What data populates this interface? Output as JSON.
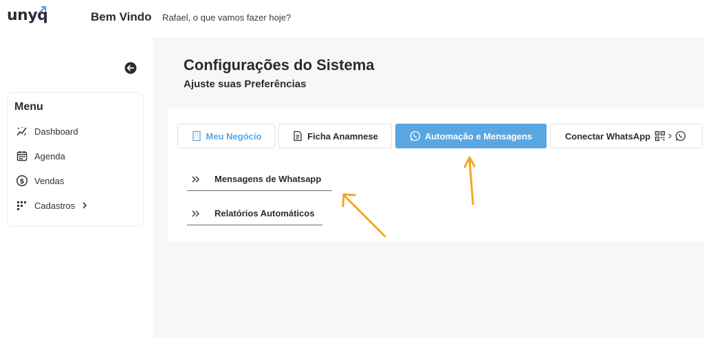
{
  "header": {
    "logo_text": "unyq",
    "welcome_title": "Bem Vindo",
    "welcome_subtitle": "Rafael, o que vamos fazer hoje?"
  },
  "sidebar": {
    "menu_title": "Menu",
    "items": [
      {
        "label": "Dashboard",
        "icon": "dashboard-icon"
      },
      {
        "label": "Agenda",
        "icon": "calendar-icon"
      },
      {
        "label": "Vendas",
        "icon": "dollar-icon"
      },
      {
        "label": "Cadastros",
        "icon": "grid-icon"
      }
    ]
  },
  "main": {
    "title": "Configurações do Sistema",
    "subtitle": "Ajuste suas Preferências",
    "tabs": [
      {
        "label": "Meu Negócio",
        "icon": "building-icon"
      },
      {
        "label": "Ficha Anamnese",
        "icon": "document-icon"
      },
      {
        "label": "Automação e Mensagens",
        "icon": "whatsapp-icon",
        "active": true
      },
      {
        "label": "Conectar WhatsApp",
        "icon": "qrcode-icon"
      }
    ],
    "submenu": [
      {
        "label": "Mensagens de Whatsapp"
      },
      {
        "label": "Relatórios Automáticos"
      }
    ]
  },
  "colors": {
    "accent": "#5aa6e0",
    "annotation_arrow": "#f5a623"
  }
}
